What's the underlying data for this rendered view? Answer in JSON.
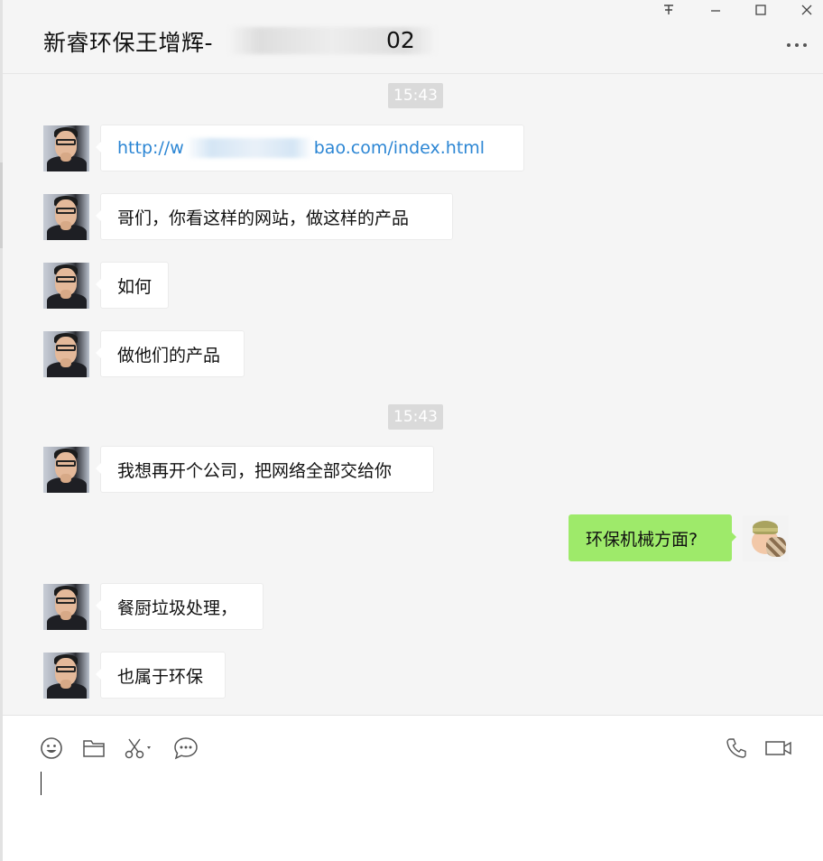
{
  "window": {
    "controls": {
      "pin": "平",
      "minimize": "–",
      "maximize": "☐",
      "close": "✕"
    }
  },
  "header": {
    "title": "新睿环保王增辉-",
    "title_tail": "02"
  },
  "timestamps": [
    "15:43",
    "15:43"
  ],
  "messages": [
    {
      "side": "recv",
      "type": "link",
      "prefix": "http://w",
      "suffix": "bao.com/index.html"
    },
    {
      "side": "recv",
      "text": "哥们，你看这样的网站，做这样的产品"
    },
    {
      "side": "recv",
      "text": "如何"
    },
    {
      "side": "recv",
      "text": "做他们的产品"
    },
    {
      "side": "recv",
      "text": "我想再开个公司，把网络全部交给你"
    },
    {
      "side": "sent",
      "text": "环保机械方面?"
    },
    {
      "side": "recv",
      "text": "餐厨垃圾处理，"
    },
    {
      "side": "recv",
      "text": "也属于环保"
    }
  ],
  "composer": {
    "tools": [
      "emoji-icon",
      "folder-icon",
      "scissors-icon",
      "chat-history-icon"
    ],
    "right_tools": [
      "phone-icon",
      "video-icon"
    ],
    "input_value": ""
  },
  "colors": {
    "chat_bg": "#f5f5f5",
    "sent_bubble": "#9eea6a",
    "recv_bubble": "#ffffff",
    "link": "#2c86d4",
    "timestamp_bg": "#dadada"
  }
}
